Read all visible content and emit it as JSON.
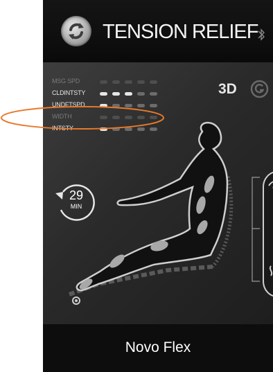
{
  "header": {
    "program_title": "TENSION RELIEF",
    "refresh_icon": "refresh-icon",
    "bluetooth_icon": "bluetooth-icon"
  },
  "settings": [
    {
      "label": "MSG SPD",
      "level": 0,
      "max": 5,
      "active": false
    },
    {
      "label": "CLDINTSTY",
      "level": 3,
      "max": 5,
      "active": true
    },
    {
      "label": "UNDFTSPD",
      "level": 1,
      "max": 5,
      "active": true,
      "highlighted": true
    },
    {
      "label": "WIDTH",
      "level": 0,
      "max": 5,
      "active": false
    },
    {
      "label": "INTSTY",
      "level": 1,
      "max": 5,
      "active": true
    }
  ],
  "mode": {
    "label_3d": "3D",
    "g_icon": "g-mode-icon"
  },
  "timer": {
    "value": "29",
    "unit": "MIN"
  },
  "footer": {
    "brand": "Novo Flex"
  },
  "colors": {
    "callout": "#e8792a",
    "dot_on": "#e6e6e6",
    "dot_off": "#6c6c6c",
    "body_fill": "#111111",
    "body_outline": "#cfcfcf"
  }
}
